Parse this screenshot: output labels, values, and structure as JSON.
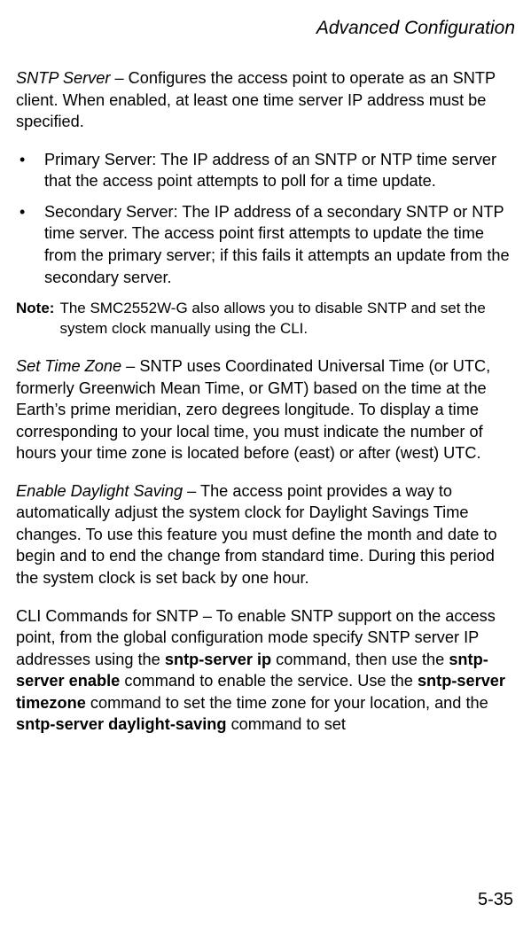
{
  "header": "Advanced Configuration",
  "sntp_server_term": "SNTP Server",
  "sntp_server_desc": " – Configures the access point to operate as an SNTP client. When enabled, at least one time server IP address must be specified.",
  "bullets": [
    "Primary Server: The IP address of an SNTP or NTP time server that the access point attempts to poll for a time update.",
    "Secondary Server: The IP address of a secondary SNTP or NTP time server. The access point first attempts to update the time from the primary server; if this fails it attempts an update from the secondary server."
  ],
  "note_label": "Note:",
  "note_text": "The SMC2552W-G also allows you to disable SNTP and set the system clock manually using the CLI.",
  "set_time_zone_term": "Set Time Zone",
  "set_time_zone_desc": " – SNTP uses Coordinated Universal Time (or UTC, formerly Greenwich Mean Time, or GMT) based on the time at the Earth’s prime meridian, zero degrees longitude. To display a time corresponding to your local time, you must indicate the number of hours your time zone is located before (east) or after (west) UTC.",
  "daylight_term": "Enable Daylight Saving",
  "daylight_desc": " – The access point provides a way to automatically adjust the system clock for Daylight Savings Time changes. To use this feature you must define the month and date to begin and to end the change from standard time. During this period the system clock is set back by one hour.",
  "cli_pre": "CLI Commands for SNTP – To enable SNTP support on the access point, from the global configuration mode specify SNTP server IP addresses using the ",
  "cli_cmd1": "sntp-server ip",
  "cli_mid1": " command, then use the ",
  "cli_cmd2": "sntp-server enable",
  "cli_mid2": " command to enable the service. Use the ",
  "cli_cmd3": "sntp-server timezone",
  "cli_mid3": " command to set the time zone for your location, and the ",
  "cli_cmd4": "sntp-server daylight-saving",
  "cli_post": " command to set",
  "page_number": "5-35"
}
